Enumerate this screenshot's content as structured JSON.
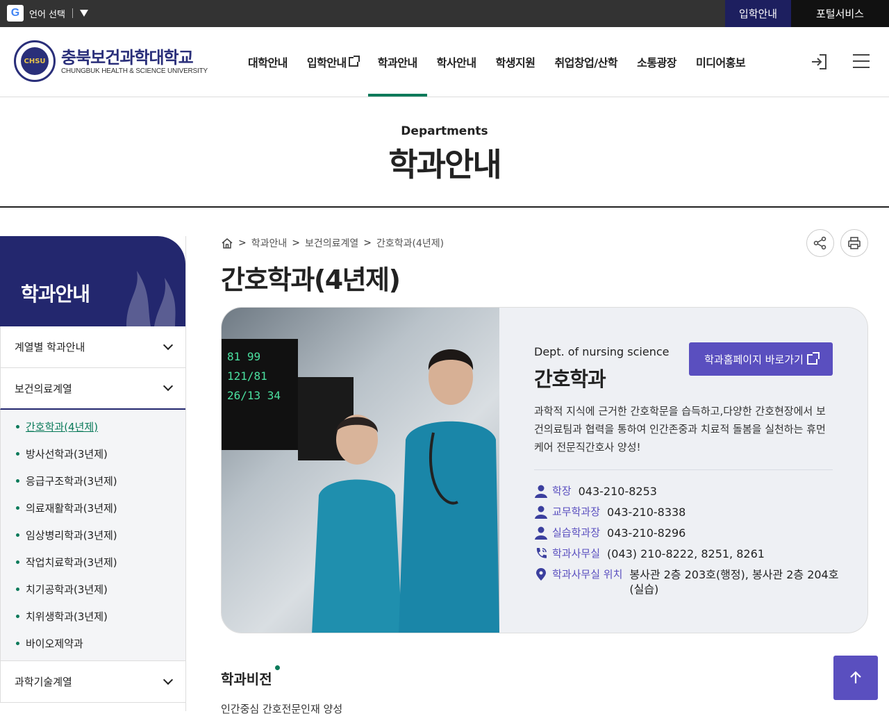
{
  "topbar": {
    "google_letter": "G",
    "language_label": "언어 선택",
    "admission_link": "입학안내",
    "portal_link": "포털서비스"
  },
  "header": {
    "logo_kr": "충북보건과학대학교",
    "logo_en": "CHUNGBUK HEALTH & SCIENCE UNIVERSITY",
    "emblem_text": "CHSU",
    "nav": [
      {
        "label": "대학안내"
      },
      {
        "label": "입학안내"
      },
      {
        "label": "학과안내"
      },
      {
        "label": "학사안내"
      },
      {
        "label": "학생지원"
      },
      {
        "label": "취업창업/산학"
      },
      {
        "label": "소통광장"
      },
      {
        "label": "미디어홍보"
      }
    ]
  },
  "title_band": {
    "en": "Departments",
    "kr": "학과안내"
  },
  "sidebar": {
    "title": "학과안내",
    "groups": [
      {
        "label": "계열별 학과안내"
      },
      {
        "label": "보건의료계열"
      },
      {
        "label": "과학기술계열"
      }
    ],
    "sub_items": [
      {
        "label": "간호학과(4년제)"
      },
      {
        "label": "방사선학과(3년제)"
      },
      {
        "label": "응급구조학과(3년제)"
      },
      {
        "label": "의료재활학과(3년제)"
      },
      {
        "label": "임상병리학과(3년제)"
      },
      {
        "label": "작업치료학과(3년제)"
      },
      {
        "label": "치기공학과(3년제)"
      },
      {
        "label": "치위생학과(3년제)"
      },
      {
        "label": "바이오제약과"
      }
    ]
  },
  "breadcrumb": {
    "items": [
      "학과안내",
      "보건의료계열",
      "간호학과(4년제)"
    ],
    "separator": ">"
  },
  "page_title": "간호학과(4년제)",
  "dept_card": {
    "en": "Dept. of nursing science",
    "kr": "간호학과",
    "homepage_button": "학과홈페이지 바로가기",
    "description": "과학적 지식에 근거한 간호학문을 습득하고,다양한 간호현장에서 보건의료팀과 협력을 통하여 인간존중과 치료적 돌봄을 실천하는 휴먼케어 전문직간호사 양성!",
    "monitor_readout": "81 99 121/81 26/13 34",
    "contacts": [
      {
        "icon": "person-icon",
        "label": "학장",
        "value": "043-210-8253"
      },
      {
        "icon": "person-icon",
        "label": "교무학과장",
        "value": "043-210-8338"
      },
      {
        "icon": "person-icon",
        "label": "실습학과장",
        "value": "043-210-8296"
      },
      {
        "icon": "phone-icon",
        "label": "학과사무실",
        "value": "(043) 210-8222, 8251, 8261"
      },
      {
        "icon": "location-pin-icon",
        "label": "학과사무실 위치",
        "value": "봉사관 2층 203호(행정), 봉사관 2층 204호(실습)"
      }
    ]
  },
  "vision": {
    "title": "학과비전",
    "text": "인간중심 간호전문인재 양성"
  },
  "colors": {
    "accent_purple": "#5a4fbf",
    "navy": "#23276e",
    "green": "#0a7a5a"
  }
}
